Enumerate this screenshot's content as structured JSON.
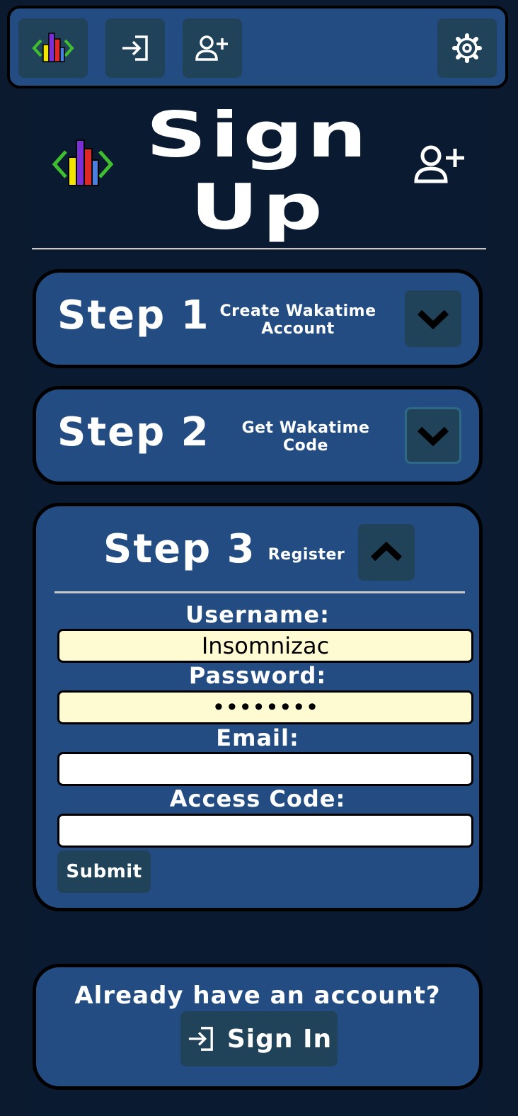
{
  "topbar": {
    "icons": [
      "app-logo-icon",
      "sign-in-icon",
      "add-user-icon",
      "gear-icon"
    ]
  },
  "hero": {
    "title_line1": "Sign",
    "title_line2": "Up"
  },
  "steps": [
    {
      "title": "Step 1",
      "subtitle_line1": "Create Wakatime",
      "subtitle_line2": "Account",
      "state": "collapsed"
    },
    {
      "title": "Step 2",
      "subtitle_line1": "Get Wakatime",
      "subtitle_line2": "Code",
      "state": "collapsed"
    },
    {
      "title": "Step 3",
      "subtitle_line1": "Register",
      "subtitle_line2": "",
      "state": "expanded"
    }
  ],
  "form": {
    "username_label": "Username:",
    "username_value": "Insomnizac",
    "password_label": "Password:",
    "password_value": "••••••••",
    "email_label": "Email:",
    "email_value": "",
    "access_code_label": "Access Code:",
    "access_code_value": "",
    "submit_label": "Submit"
  },
  "signin_card": {
    "prompt": "Already have an account?",
    "button_label": "Sign In"
  },
  "colors": {
    "background": "#0b1a2e",
    "panel": "#234c82",
    "button": "#21435a",
    "input_filled": "#fefad2"
  }
}
